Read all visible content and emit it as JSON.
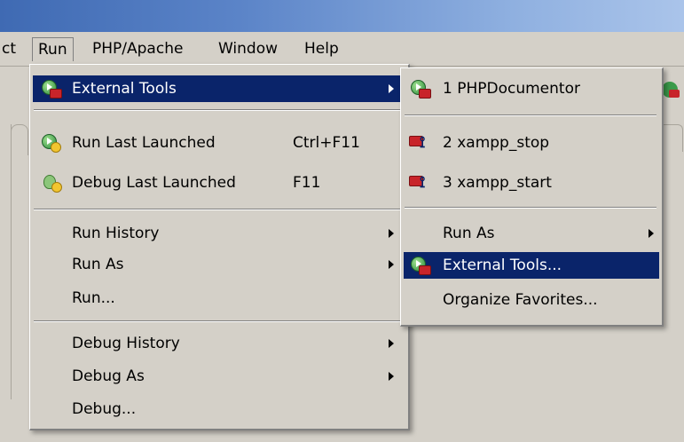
{
  "menubar": {
    "items": [
      "ct",
      "Run",
      "PHP/Apache",
      "Window",
      "Help"
    ]
  },
  "run_menu": {
    "items": [
      {
        "label": "External Tools",
        "icon": "external-tools-icon",
        "submenu": true,
        "highlighted": true
      },
      {
        "label": "Run Last Launched",
        "shortcut": "Ctrl+F11",
        "icon": "run-last-launched-icon"
      },
      {
        "label": "Debug Last Launched",
        "shortcut": "F11",
        "icon": "debug-last-launched-icon"
      },
      {
        "label": "Run History",
        "submenu": true
      },
      {
        "label": "Run As",
        "submenu": true
      },
      {
        "label": "Run..."
      },
      {
        "label": "Debug History",
        "submenu": true
      },
      {
        "label": "Debug As",
        "submenu": true
      },
      {
        "label": "Debug..."
      }
    ]
  },
  "external_tools_submenu": {
    "items": [
      {
        "label": "1 PHPDocumentor",
        "icon": "external-tools-icon"
      },
      {
        "label": "2 xampp_stop",
        "icon": "xampp-icon"
      },
      {
        "label": "3 xampp_start",
        "icon": "xampp-icon"
      },
      {
        "label": "Run As",
        "submenu": true
      },
      {
        "label": "External Tools...",
        "icon": "external-tools-icon",
        "highlighted": true
      },
      {
        "label": "Organize Favorites..."
      }
    ]
  },
  "colors": {
    "highlight": "#0a246a",
    "menu_background": "#d4d0c8"
  }
}
